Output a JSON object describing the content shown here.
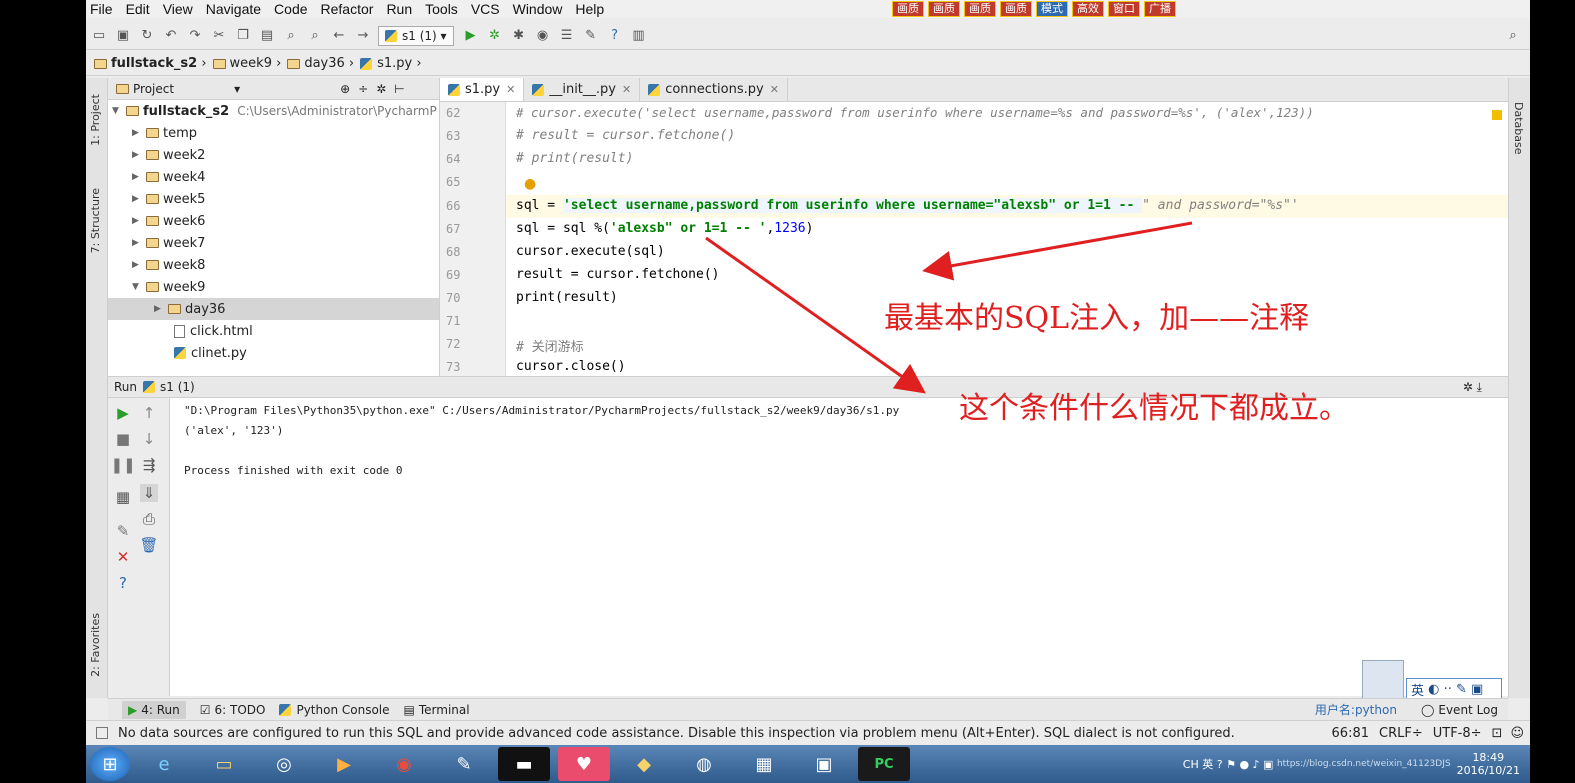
{
  "menu": [
    "File",
    "Edit",
    "View",
    "Navigate",
    "Code",
    "Refactor",
    "Run",
    "Tools",
    "VCS",
    "Window",
    "Help"
  ],
  "top_buttons": [
    "画质",
    "画质",
    "画质",
    "画质",
    "模式",
    "高效",
    "窗口",
    "广播"
  ],
  "toolbar": {
    "run_config": "s1 (1)"
  },
  "breadcrumb": [
    "fullstack_s2",
    "week9",
    "day36",
    "s1.py"
  ],
  "sidebar_left": {
    "project": "1: Project",
    "structure": "7: Structure",
    "favorites": "2: Favorites"
  },
  "sidebar_right": {
    "database": "Database"
  },
  "project_panel": {
    "title": "Project",
    "root_name": "fullstack_s2",
    "root_path": "C:\\Users\\Administrator\\PycharmP",
    "items": [
      {
        "label": "temp",
        "arrow": "▶"
      },
      {
        "label": "week2",
        "arrow": "▶"
      },
      {
        "label": "week4",
        "arrow": "▶"
      },
      {
        "label": "week5",
        "arrow": "▶"
      },
      {
        "label": "week6",
        "arrow": "▶"
      },
      {
        "label": "week7",
        "arrow": "▶"
      },
      {
        "label": "week8",
        "arrow": "▶"
      },
      {
        "label": "week9",
        "arrow": "▼"
      },
      {
        "label": "day36",
        "arrow": "▶"
      },
      {
        "label": "click.html",
        "arrow": ""
      },
      {
        "label": "clinet.py",
        "arrow": ""
      }
    ]
  },
  "editor_tabs": [
    {
      "label": "s1.py"
    },
    {
      "label": "__init__.py"
    },
    {
      "label": "connections.py"
    }
  ],
  "code": {
    "ln62": "62",
    "l62": "# cursor.execute('select username,password from userinfo where username=%s and password=%s', ('alex',123))",
    "ln63": "63",
    "l63": "# result = cursor.fetchone()",
    "ln64": "64",
    "l64": "# print(result)",
    "ln65": "65",
    "ln66": "66",
    "l66a": "sql = ",
    "l66b": "'select username,password from userinfo where username=\"alexsb\" or 1=1 -- ",
    "l66c": "\" and password=\"%s\"'",
    "ln67": "67",
    "l67a": "sql = sql %(",
    "l67b": "'alexsb\" or 1=1 -- '",
    "l67c": ",",
    "l67d": "1236",
    "l67e": ")",
    "ln68": "68",
    "l68": "cursor.execute(sql)",
    "ln69": "69",
    "l69": "result = cursor.fetchone()",
    "ln70": "70",
    "l70": "print(result)",
    "ln71": "71",
    "ln72": "72",
    "l72": "# 关闭游标",
    "ln73": "73",
    "l73": "cursor.close()"
  },
  "run_panel": {
    "label": "Run",
    "config": "s1 (1)"
  },
  "console": {
    "line1": "\"D:\\Program Files\\Python35\\python.exe\" C:/Users/Administrator/PycharmProjects/fullstack_s2/week9/day36/s1.py",
    "line2": "('alex', '123')",
    "line3": "Process finished with exit code 0"
  },
  "bottom_tabs": [
    "4: Run",
    "6: TODO",
    "Python Console",
    "Terminal"
  ],
  "event_log": "Event Log",
  "username_tag": "用户名:python",
  "ime": {
    "lang": "英"
  },
  "status": {
    "message": "No data sources are configured to run this SQL and provide advanced code assistance. Disable this inspection via problem menu (Alt+Enter). SQL dialect is not configured.",
    "position": "66:81",
    "line_sep": "CRLF÷",
    "encoding": "UTF-8÷"
  },
  "annotations": {
    "a1": "最基本的SQL注入，加——注释",
    "a2": "这个条件什么情况下都成立。"
  },
  "taskbar": {
    "tray_lang": "CH",
    "tray_ime": "英",
    "time": "18:49",
    "date": "2016/10/21",
    "watermark": "https://blog.csdn.net/weixin_41123DJS"
  },
  "colors": {
    "annotation": "#e02020",
    "taskbar": "#2f5a8c"
  }
}
